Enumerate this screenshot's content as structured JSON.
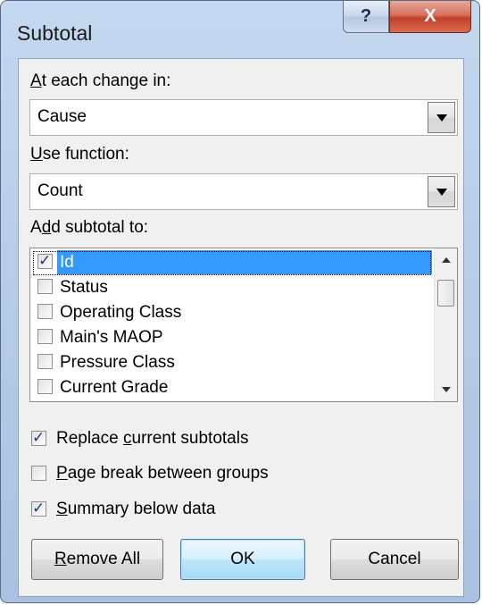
{
  "dialog": {
    "title": "Subtotal",
    "help_glyph": "?",
    "close_glyph": "X"
  },
  "group_by": {
    "label_prefix": "",
    "label_accel": "A",
    "label_rest": "t each change in:",
    "value": "Cause"
  },
  "function": {
    "label_accel": "U",
    "label_rest": "se function:",
    "value": "Count"
  },
  "subtotal_to": {
    "label_start": "A",
    "label_accel": "d",
    "label_rest": "d subtotal to:",
    "items": [
      {
        "label": "Id",
        "checked": true,
        "selected": true
      },
      {
        "label": "Status",
        "checked": false,
        "selected": false
      },
      {
        "label": "Operating Class",
        "checked": false,
        "selected": false
      },
      {
        "label": "Main's MAOP",
        "checked": false,
        "selected": false
      },
      {
        "label": "Pressure Class",
        "checked": false,
        "selected": false
      },
      {
        "label": "Current Grade",
        "checked": false,
        "selected": false
      }
    ]
  },
  "options": {
    "replace": {
      "checked": true,
      "pre": "Replace ",
      "accel": "c",
      "post": "urrent subtotals"
    },
    "page_break": {
      "checked": false,
      "pre": "",
      "accel": "P",
      "post": "age break between groups"
    },
    "summary": {
      "checked": true,
      "pre": "",
      "accel": "S",
      "post": "ummary below data"
    }
  },
  "buttons": {
    "remove_all": {
      "accel": "R",
      "rest": "emove All"
    },
    "ok": "OK",
    "cancel": "Cancel"
  },
  "colors": {
    "selection": "#3399ff",
    "frame": "#b7cde8",
    "close_red": "#c1422c"
  }
}
